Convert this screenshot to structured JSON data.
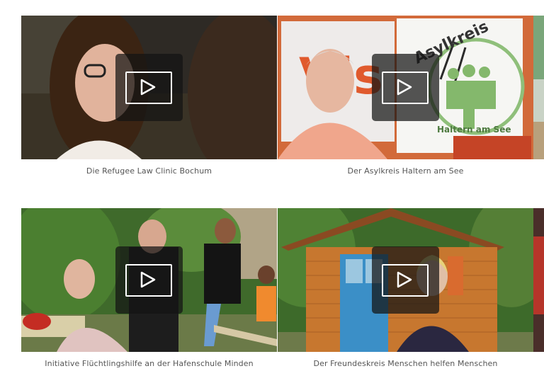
{
  "videos": [
    {
      "caption": "Die Refugee Law Clinic Bochum",
      "play_icon": "play-icon"
    },
    {
      "caption": "Der Asylkreis Haltern am See",
      "play_icon": "play-icon",
      "sign_text": "Asylkreis",
      "sign_subtext": "Haltern am See",
      "poster_text": "Vis"
    },
    {
      "caption": "Initiative Flüchtlingshilfe an der Hafenschule Minden",
      "play_icon": "play-icon"
    },
    {
      "caption": "Der Freundeskreis Menschen helfen Menschen",
      "play_icon": "play-icon"
    }
  ],
  "colors": {
    "accent": "#ffffff",
    "caption_text": "#555555",
    "play_bg": "#141414"
  }
}
